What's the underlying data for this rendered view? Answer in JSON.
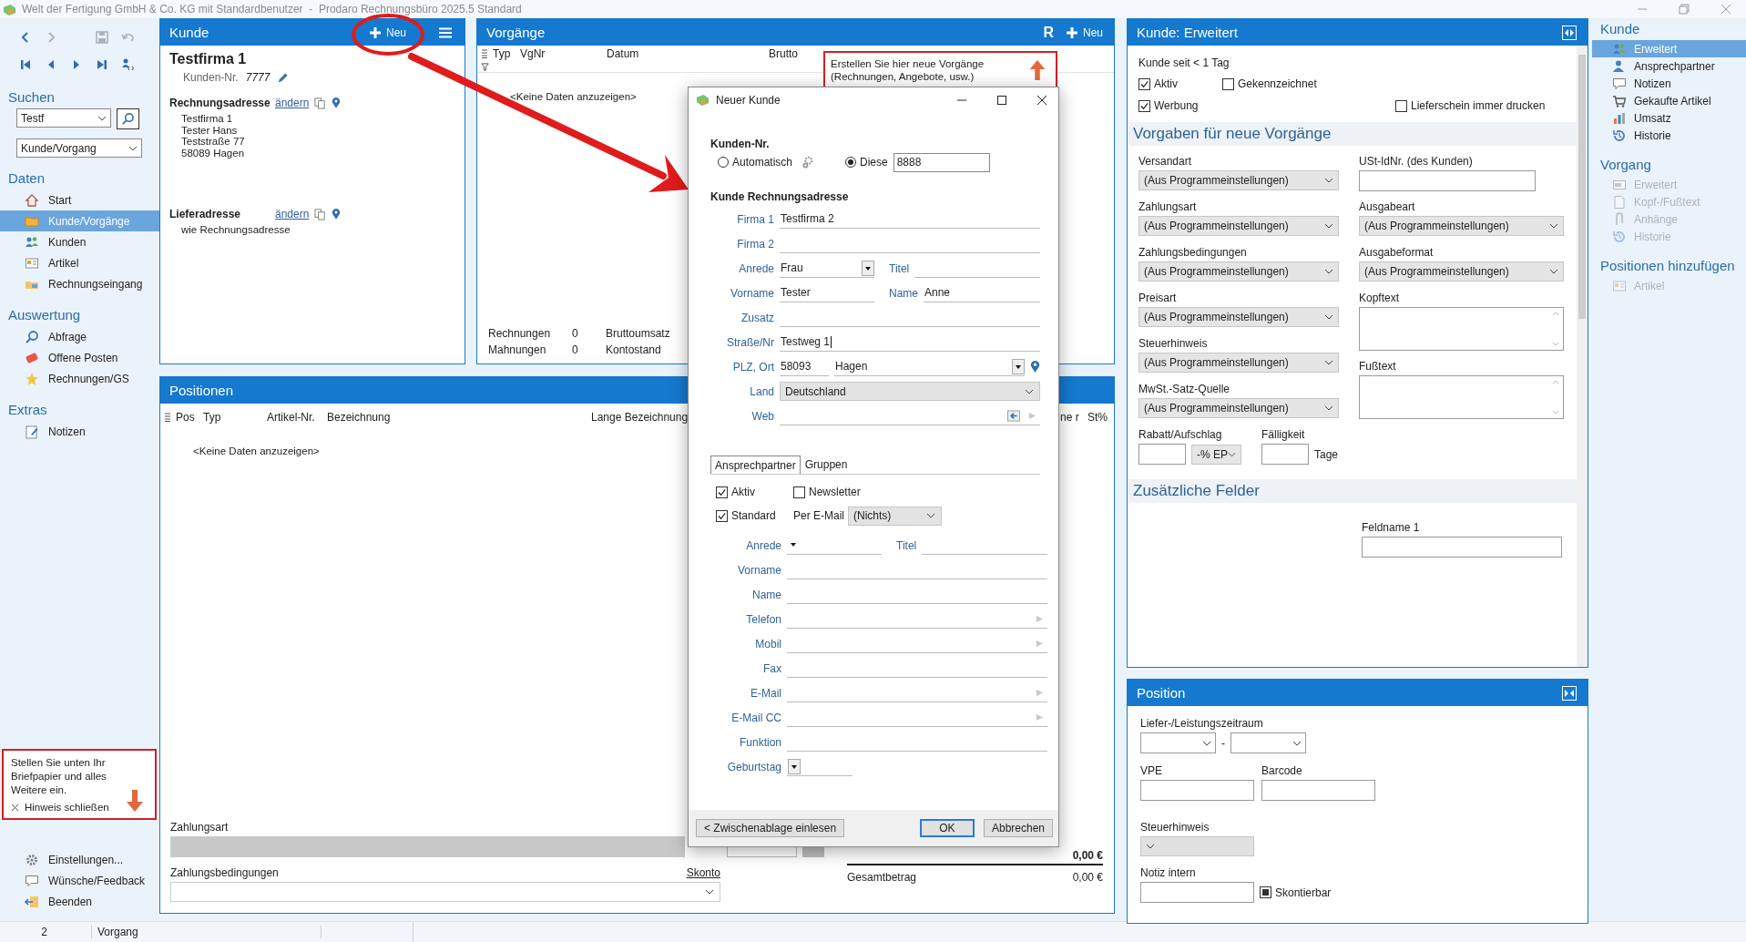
{
  "window": {
    "title": "Welt der Fertigung GmbH & Co. KG mit Standardbenutzer  -  Prodaro Rechnungsbüro 2025.5 Standard"
  },
  "sidebar": {
    "nav_toolbar": [
      {
        "disabled": false
      },
      {
        "disabled": true
      },
      {
        "disabled": true
      },
      {
        "disabled": true
      },
      {
        "disabled": false
      },
      {
        "disabled": false
      },
      {
        "disabled": false
      },
      {
        "disabled": false
      },
      {
        "disabled": false
      }
    ],
    "search_heading": "Suchen",
    "search_value": "Testf",
    "search_scope": "Kunde/Vorgang",
    "sections": [
      {
        "heading": "Daten",
        "items": [
          {
            "label": "Start",
            "selected": false
          },
          {
            "label": "Kunde/Vorgänge",
            "selected": true
          },
          {
            "label": "Kunden",
            "selected": false
          },
          {
            "label": "Artikel",
            "selected": false
          },
          {
            "label": "Rechnungseingang",
            "selected": false
          }
        ]
      },
      {
        "heading": "Auswertung",
        "items": [
          {
            "label": "Abfrage",
            "selected": false
          },
          {
            "label": "Offene Posten",
            "selected": false
          },
          {
            "label": "Rechnungen/GS",
            "selected": false
          }
        ]
      },
      {
        "heading": "Extras",
        "items": [
          {
            "label": "Notizen",
            "selected": false
          }
        ]
      }
    ],
    "hint": {
      "text": "Stellen Sie unten Ihr Briefpapier und alles Weitere ein.",
      "close": "Hinweis schließen"
    },
    "bottom_items": [
      {
        "label": "Einstellungen..."
      },
      {
        "label": "Wünsche/Feedback"
      },
      {
        "label": "Beenden"
      }
    ]
  },
  "customer_panel": {
    "title": "Kunde",
    "new_button": "Neu",
    "name": "Testfirma 1",
    "number_label": "Kunden-Nr.",
    "number": "7777",
    "billing_label": "Rechnungsadresse",
    "billing_link": "ändern",
    "billing_lines": [
      "Testfirma 1",
      "Tester Hans",
      "Teststraße 77",
      "58089 Hagen"
    ],
    "delivery_label": "Lieferadresse",
    "delivery_link": "ändern",
    "delivery_lines": [
      "wie Rechnungsadresse"
    ]
  },
  "transactions_panel": {
    "title": "Vorgänge",
    "r_button": "R",
    "new_button": "Neu",
    "columns": [
      "Typ",
      "VgNr",
      "Datum",
      "Brutto"
    ],
    "empty": "<Keine Daten anzuzeigen>",
    "hint": "Erstellen Sie hier neue Vorgänge (Rechnungen, Angebote, usw.)",
    "summary": [
      {
        "label": "Rechnungen",
        "value": "0",
        "label_2": "Bruttoumsatz"
      },
      {
        "label": "Mahnungen",
        "value": "0",
        "label_2": "Kontostand"
      }
    ]
  },
  "positions_panel": {
    "title": "Positionen",
    "columns": [
      "Pos",
      "Typ",
      "Artikel-Nr.",
      "Bezeichnung",
      "Lange Bezeichnung",
      "ne r",
      "St%"
    ],
    "empty": "<Keine Daten anzuzeigen>",
    "payment_type_label": "Zahlungsart",
    "payment_terms_label": "Zahlungsbedingungen",
    "discount_link": "Skonto",
    "net_total": "0,00 €",
    "gross_label": "Gesamtbetrag",
    "gross_total": "0,00 €"
  },
  "extended_panel": {
    "title": "Kunde: Erweitert",
    "since": "Kunde seit < 1 Tag",
    "checkboxes": [
      {
        "label": "Aktiv",
        "checked": true
      },
      {
        "label": "Gekennzeichnet",
        "checked": false
      },
      {
        "label": "Werbung",
        "checked": true
      },
      {
        "label": "Lieferschein immer drucken",
        "checked": false
      }
    ],
    "defaults_heading": "Vorgaben für neue Vorgänge",
    "left_fields": [
      {
        "label": "Versandart",
        "value": "(Aus Programmeinstellungen)"
      },
      {
        "label": "Zahlungsart",
        "value": "(Aus Programmeinstellungen)"
      },
      {
        "label": "Zahlungsbedingungen",
        "value": "(Aus Programmeinstellungen)"
      },
      {
        "label": "Preisart",
        "value": "(Aus Programmeinstellungen)"
      },
      {
        "label": "Steuerhinweis",
        "value": "(Aus Programmeinstellungen)"
      },
      {
        "label": "MwSt.-Satz-Quelle",
        "value": "(Aus Programmeinstellungen)"
      }
    ],
    "right_fields": [
      {
        "kind": "text",
        "label": "USt-IdNr. (des Kunden)"
      },
      {
        "kind": "select",
        "label": "Ausgabeart",
        "value": "(Aus Programmeinstellungen)"
      },
      {
        "kind": "select",
        "label": "Ausgabeformat",
        "value": "(Aus Programmeinstellungen)"
      },
      {
        "kind": "textarea",
        "label": "Kopftext"
      },
      {
        "kind": "textarea",
        "label": "Fußtext"
      }
    ],
    "discount_label": "Rabatt/Aufschlag",
    "discount_unit": "-% EP",
    "due_label": "Fälligkeit",
    "due_unit": "Tage",
    "extra_heading": "Zusätzliche Felder",
    "extra_fields": [
      {
        "label": "Feldname 1"
      }
    ]
  },
  "position_panel": {
    "title": "Position",
    "period_label": "Liefer-/Leistungszeitraum",
    "period_separator": "-",
    "vpe_label": "VPE",
    "barcode_label": "Barcode",
    "tax_label": "Steuerhinweis",
    "note_label": "Notiz intern",
    "discountable": {
      "label": "Skontierbar",
      "checked": true
    }
  },
  "right_nav": {
    "sections": [
      {
        "heading": "Kunde",
        "items": [
          {
            "label": "Erweitert",
            "selected": true,
            "disabled": false
          },
          {
            "label": "Ansprechpartner",
            "selected": false,
            "disabled": false
          },
          {
            "label": "Notizen",
            "selected": false,
            "disabled": false
          },
          {
            "label": "Gekaufte Artikel",
            "selected": false,
            "disabled": false
          },
          {
            "label": "Umsatz",
            "selected": false,
            "disabled": false
          },
          {
            "label": "Historie",
            "selected": false,
            "disabled": false
          }
        ]
      },
      {
        "heading": "Vorgang",
        "items": [
          {
            "label": "Erweitert",
            "selected": false,
            "disabled": true
          },
          {
            "label": "Kopf-/Fußtext",
            "selected": false,
            "disabled": true
          },
          {
            "label": "Anhänge",
            "selected": false,
            "disabled": true
          },
          {
            "label": "Historie",
            "selected": false,
            "disabled": true
          }
        ]
      },
      {
        "heading": "Positionen hinzufügen",
        "items": [
          {
            "label": "Artikel",
            "selected": false,
            "disabled": true
          }
        ]
      }
    ]
  },
  "dialog": {
    "title": "Neuer Kunde",
    "number_heading": "Kunden-Nr.",
    "number_options": [
      {
        "label": "Automatisch",
        "selected": false
      },
      {
        "label": "Diese",
        "selected": true
      }
    ],
    "number_value": "8888",
    "address_heading": "Kunde Rechnungsadresse",
    "address_rows": [
      {
        "label": "Firma 1",
        "fields": [
          {
            "kind": "text",
            "value": "Testfirma 2"
          }
        ]
      },
      {
        "label": "Firma 2",
        "fields": [
          {
            "kind": "text"
          }
        ]
      },
      {
        "label": "Anrede",
        "fields": [
          {
            "kind": "dropdown",
            "value": "Frau"
          },
          {
            "kind": "text",
            "label": "Titel"
          }
        ]
      },
      {
        "label": "Vorname",
        "fields": [
          {
            "kind": "text",
            "value": "Tester"
          },
          {
            "kind": "text",
            "label": "Name",
            "value": "Anne"
          }
        ]
      },
      {
        "label": "Zusatz",
        "fields": [
          {
            "kind": "text"
          }
        ]
      },
      {
        "label": "Straße/Nr",
        "fields": [
          {
            "kind": "text",
            "value": "Testweg 1",
            "focused": true
          }
        ]
      },
      {
        "label": "PLZ, Ort",
        "fields": [
          {
            "kind": "text",
            "value": "58093"
          },
          {
            "kind": "city",
            "value": "Hagen"
          }
        ]
      },
      {
        "label": "Land",
        "fields": [
          {
            "kind": "select",
            "value": "Deutschland"
          }
        ]
      },
      {
        "label": "Web",
        "fields": [
          {
            "kind": "web"
          }
        ]
      }
    ],
    "tabs": [
      {
        "label": "Ansprechpartner",
        "selected": true
      },
      {
        "label": "Gruppen",
        "selected": false
      }
    ],
    "contact_checks": [
      {
        "label": "Aktiv",
        "checked": true
      },
      {
        "label": "Newsletter",
        "checked": false
      },
      {
        "label": "Standard",
        "checked": true
      }
    ],
    "email_label": "Per E-Mail",
    "email_value": "(Nichts)",
    "contact_rows": [
      {
        "label": "Anrede",
        "fields": [
          {
            "kind": "dropdown"
          },
          {
            "kind": "text",
            "label": "Titel"
          }
        ]
      },
      {
        "label": "Vorname",
        "fields": [
          {
            "kind": "text"
          }
        ]
      },
      {
        "label": "Name",
        "fields": [
          {
            "kind": "text"
          }
        ]
      },
      {
        "label": "Telefon",
        "fields": [
          {
            "kind": "link"
          }
        ]
      },
      {
        "label": "Mobil",
        "fields": [
          {
            "kind": "link"
          }
        ]
      },
      {
        "label": "Fax",
        "fields": [
          {
            "kind": "text"
          }
        ]
      },
      {
        "label": "E-Mail",
        "fields": [
          {
            "kind": "link"
          }
        ]
      },
      {
        "label": "E-Mail CC",
        "fields": [
          {
            "kind": "link"
          }
        ]
      },
      {
        "label": "Funktion",
        "fields": [
          {
            "kind": "text"
          }
        ]
      },
      {
        "label": "Geburtstag",
        "fields": [
          {
            "kind": "date"
          }
        ]
      }
    ],
    "buttons": [
      {
        "label": "< Zwischenablage einlesen",
        "default": false
      },
      {
        "label": "OK",
        "default": true
      },
      {
        "label": "Abbrechen",
        "default": false
      }
    ]
  },
  "status_bar": {
    "count": "2",
    "label": "Vorgang"
  }
}
